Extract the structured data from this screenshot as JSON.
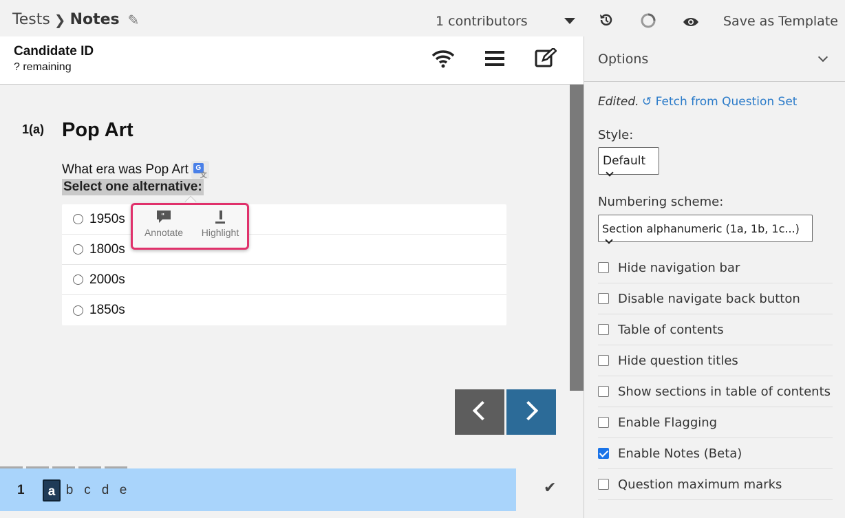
{
  "header": {
    "breadcrumb_root": "Tests",
    "breadcrumb_current": "Notes",
    "contributors": "1 contributors",
    "save_template": "Save as Template"
  },
  "candidate": {
    "id_label": "Candidate ID",
    "remaining": "? remaining"
  },
  "question": {
    "number": "1(a)",
    "title": "Pop Art",
    "text": "What era was Pop Art",
    "instruction": "Select one alternative:",
    "choices": [
      "1950s",
      "1800s",
      "2000s",
      "1850s"
    ]
  },
  "popup": {
    "annotate": "Annotate",
    "highlight": "Highlight"
  },
  "question_bar": {
    "number": "1",
    "parts": [
      "a",
      "b",
      "c",
      "d",
      "e"
    ],
    "active_part": "a"
  },
  "options": {
    "title": "Options",
    "edited": "Edited.",
    "fetch": "Fetch from Question Set",
    "style_label": "Style:",
    "style_value": "Default",
    "numbering_label": "Numbering scheme:",
    "numbering_value": "Section alphanumeric (1a, 1b, 1c...)",
    "items": [
      {
        "label": "Hide navigation bar",
        "checked": false
      },
      {
        "label": "Disable navigate back button",
        "checked": false
      },
      {
        "label": "Table of contents",
        "checked": false
      },
      {
        "label": "Hide question titles",
        "checked": false
      },
      {
        "label": "Show sections in table of contents",
        "checked": false
      },
      {
        "label": "Enable Flagging",
        "checked": false
      },
      {
        "label": "Enable Notes (Beta)",
        "checked": true
      },
      {
        "label": "Question maximum marks",
        "checked": false
      }
    ]
  },
  "colors": {
    "accent_blue": "#2b7bc9",
    "next_button": "#2c6b98",
    "popup_border": "#e0316b",
    "question_bar": "#a9d4fb"
  }
}
